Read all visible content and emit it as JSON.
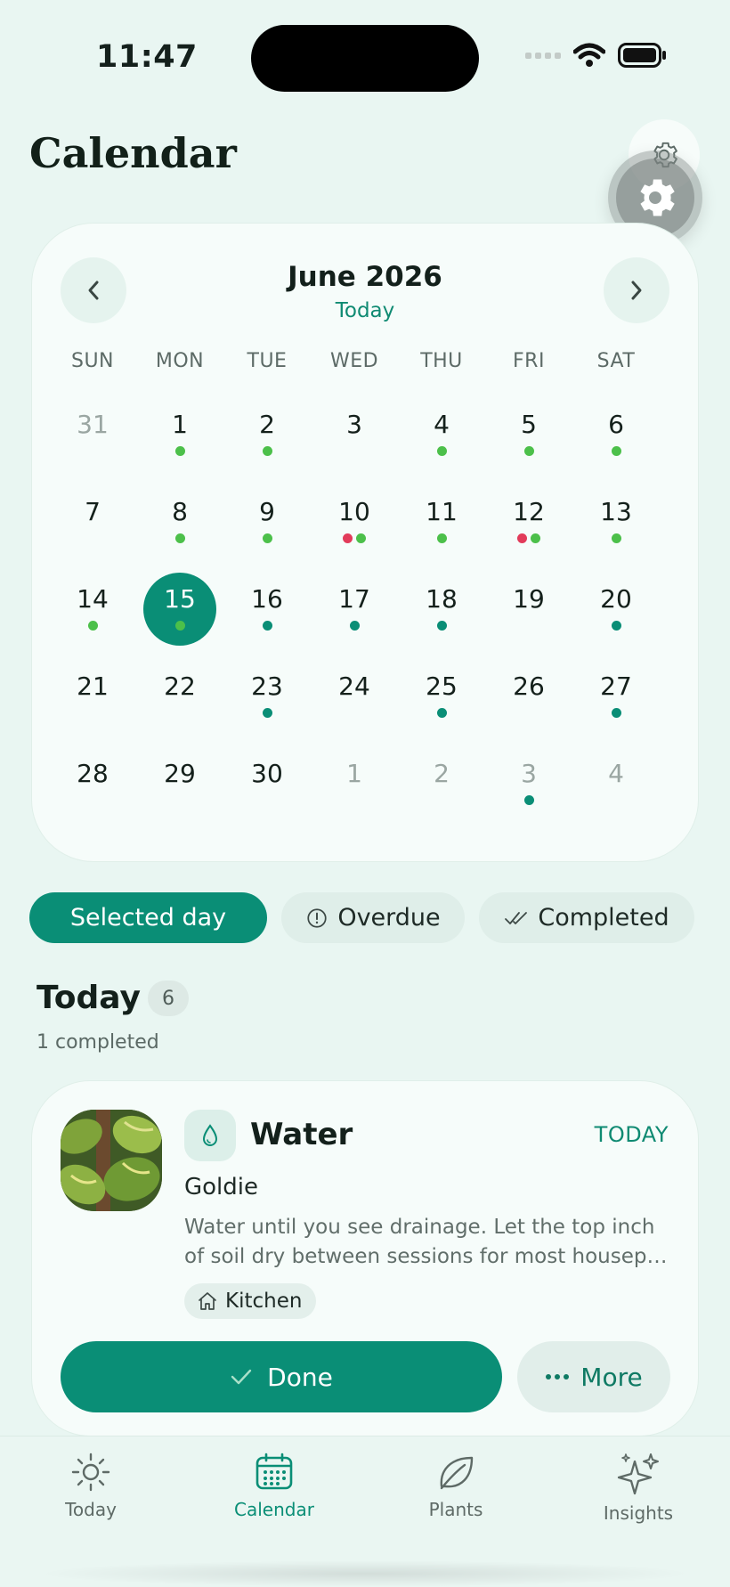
{
  "status_bar": {
    "time": "11:47"
  },
  "header": {
    "title": "Calendar",
    "settings_icon": "gear-icon"
  },
  "calendar": {
    "month_label": "June 2026",
    "today_link": "Today",
    "weekdays": [
      "SUN",
      "MON",
      "TUE",
      "WED",
      "THU",
      "FRI",
      "SAT"
    ],
    "colors": {
      "done_green": "#4cc04a",
      "upcoming_teal": "#0a8e76",
      "overdue_red": "#e23b5a"
    },
    "selected_day": "15",
    "days": [
      {
        "n": "31",
        "other": true,
        "dots": []
      },
      {
        "n": "1",
        "other": false,
        "dots": [
          "g"
        ]
      },
      {
        "n": "2",
        "other": false,
        "dots": [
          "g"
        ]
      },
      {
        "n": "3",
        "other": false,
        "dots": []
      },
      {
        "n": "4",
        "other": false,
        "dots": [
          "g"
        ]
      },
      {
        "n": "5",
        "other": false,
        "dots": [
          "g"
        ]
      },
      {
        "n": "6",
        "other": false,
        "dots": [
          "g"
        ]
      },
      {
        "n": "7",
        "other": false,
        "dots": []
      },
      {
        "n": "8",
        "other": false,
        "dots": [
          "g"
        ]
      },
      {
        "n": "9",
        "other": false,
        "dots": [
          "g"
        ]
      },
      {
        "n": "10",
        "other": false,
        "dots": [
          "r",
          "g"
        ]
      },
      {
        "n": "11",
        "other": false,
        "dots": [
          "g"
        ]
      },
      {
        "n": "12",
        "other": false,
        "dots": [
          "r",
          "g"
        ]
      },
      {
        "n": "13",
        "other": false,
        "dots": [
          "g"
        ]
      },
      {
        "n": "14",
        "other": false,
        "dots": [
          "g"
        ]
      },
      {
        "n": "15",
        "other": false,
        "dots": [
          "g"
        ],
        "selected": true
      },
      {
        "n": "16",
        "other": false,
        "dots": [
          "t"
        ]
      },
      {
        "n": "17",
        "other": false,
        "dots": [
          "t"
        ]
      },
      {
        "n": "18",
        "other": false,
        "dots": [
          "t"
        ]
      },
      {
        "n": "19",
        "other": false,
        "dots": []
      },
      {
        "n": "20",
        "other": false,
        "dots": [
          "t"
        ]
      },
      {
        "n": "21",
        "other": false,
        "dots": []
      },
      {
        "n": "22",
        "other": false,
        "dots": []
      },
      {
        "n": "23",
        "other": false,
        "dots": [
          "t"
        ]
      },
      {
        "n": "24",
        "other": false,
        "dots": []
      },
      {
        "n": "25",
        "other": false,
        "dots": [
          "t"
        ]
      },
      {
        "n": "26",
        "other": false,
        "dots": []
      },
      {
        "n": "27",
        "other": false,
        "dots": [
          "t"
        ]
      },
      {
        "n": "28",
        "other": false,
        "dots": []
      },
      {
        "n": "29",
        "other": false,
        "dots": []
      },
      {
        "n": "30",
        "other": false,
        "dots": []
      },
      {
        "n": "1",
        "other": true,
        "dots": []
      },
      {
        "n": "2",
        "other": true,
        "dots": []
      },
      {
        "n": "3",
        "other": true,
        "dots": [
          "t"
        ]
      },
      {
        "n": "4",
        "other": true,
        "dots": []
      }
    ]
  },
  "filters": {
    "selected_day": "Selected day",
    "overdue": "Overdue",
    "completed": "Completed"
  },
  "section": {
    "title": "Today",
    "count": "6",
    "subtitle": "1 completed"
  },
  "task": {
    "type_icon": "water-drop-icon",
    "title": "Water",
    "when": "TODAY",
    "plant": "Goldie",
    "description": "Water until you see drainage. Let the top inch of soil dry between sessions for most housep…",
    "location": "Kitchen",
    "done_label": "Done",
    "more_label": "More"
  },
  "tabs": [
    {
      "label": "Today",
      "icon": "sun-icon",
      "active": false
    },
    {
      "label": "Calendar",
      "icon": "calendar-icon",
      "active": true
    },
    {
      "label": "Plants",
      "icon": "leaf-icon",
      "active": false
    },
    {
      "label": "Insights",
      "icon": "sparkles-icon",
      "active": false
    }
  ]
}
